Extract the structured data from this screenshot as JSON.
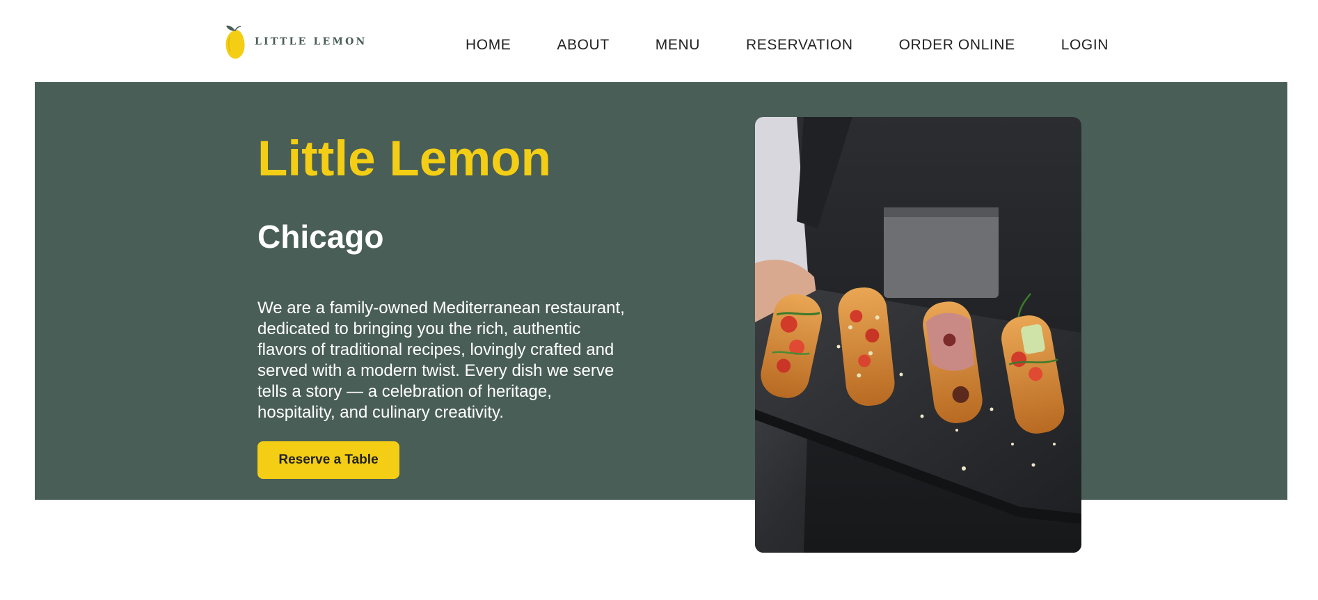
{
  "brand": {
    "logo_text": "LITTLE LEMON",
    "logo_icon": "lemon-icon",
    "colors": {
      "primary_green": "#495e57",
      "primary_yellow": "#f4ce14",
      "dark": "#222222"
    }
  },
  "nav": {
    "items": [
      {
        "label": "HOME"
      },
      {
        "label": "ABOUT"
      },
      {
        "label": "MENU"
      },
      {
        "label": "RESERVATION"
      },
      {
        "label": "ORDER ONLINE"
      },
      {
        "label": "LOGIN"
      }
    ]
  },
  "hero": {
    "title": "Little Lemon",
    "subtitle": "Chicago",
    "description": "We are a family-owned Mediterranean restaurant, dedicated to bringing you the rich, authentic flavors of traditional recipes, lovingly crafted and served with a modern twist. Every dish we serve tells a story — a celebration of heritage, hospitality, and culinary creativity.",
    "cta_label": "Reserve a Table",
    "image_icon": "food-platter-image"
  }
}
